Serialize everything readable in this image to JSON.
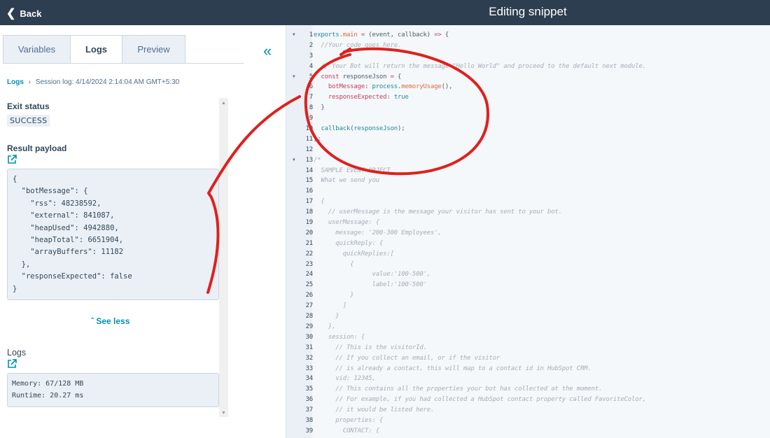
{
  "header": {
    "back_label": "Back",
    "title": "Editing snippet"
  },
  "tabs": [
    {
      "label": "Variables"
    },
    {
      "label": "Logs"
    },
    {
      "label": "Preview"
    }
  ],
  "breadcrumb": {
    "root": "Logs",
    "separator": "›",
    "current": "Session log: 4/14/2024 2:14:04 AM GMT+5:30"
  },
  "exit_status": {
    "heading": "Exit status",
    "value": "SUCCESS"
  },
  "result_payload": {
    "heading": "Result payload",
    "lines": [
      "{",
      "  \"botMessage\": {",
      "    \"rss\": 48238592,",
      "    \"external\": 841087,",
      "    \"heapUsed\": 4942880,",
      "    \"heapTotal\": 6651904,",
      "    \"arrayBuffers\": 11182",
      "  },",
      "  \"responseExpected\": false",
      "}"
    ]
  },
  "see_less_label": "See less",
  "logs": {
    "heading": "Logs",
    "lines": [
      "Memory: 67/128 MB",
      "Runtime: 20.27 ms"
    ]
  },
  "annotation_color": "#e0201c",
  "code_folds": [
    1,
    5,
    13
  ],
  "code": [
    [
      [
        "exports",
        "t"
      ],
      [
        ".",
        "p"
      ],
      [
        "main",
        "f"
      ],
      [
        " = ",
        "k"
      ],
      [
        "(event, callback) ",
        "p"
      ],
      [
        "=>",
        "k"
      ],
      [
        " {",
        "p"
      ]
    ],
    [
      [
        "  //Your code goes here.",
        "c"
      ]
    ],
    [],
    [
      [
        "  // Your Bot will return the message \"Hello World\" and proceed to the default next module.",
        "c"
      ]
    ],
    [
      [
        "  ",
        "p"
      ],
      [
        "const",
        "k"
      ],
      [
        " responseJson ",
        "p"
      ],
      [
        "=",
        "k"
      ],
      [
        " {",
        "p"
      ]
    ],
    [
      [
        "    ",
        "p"
      ],
      [
        "botMessage",
        "k"
      ],
      [
        ": ",
        "p"
      ],
      [
        "process",
        "t"
      ],
      [
        ".",
        "p"
      ],
      [
        "memoryUsage",
        "f"
      ],
      [
        "(),",
        "p"
      ]
    ],
    [
      [
        "    ",
        "p"
      ],
      [
        "responseExpected",
        "k"
      ],
      [
        ": ",
        "p"
      ],
      [
        "true",
        "t"
      ]
    ],
    [
      [
        "  }",
        "p"
      ]
    ],
    [],
    [
      [
        "  ",
        "p"
      ],
      [
        "callback",
        "t"
      ],
      [
        "(",
        "p"
      ],
      [
        "responseJson",
        "t"
      ],
      [
        ");",
        "p"
      ]
    ],
    [
      [
        "};",
        "p"
      ]
    ],
    [],
    [
      [
        "/*",
        "c"
      ]
    ],
    [
      [
        "  SAMPLE EVENT OBJECT",
        "c"
      ]
    ],
    [
      [
        "  What we send you",
        "c"
      ]
    ],
    [],
    [
      [
        "  {",
        "c"
      ]
    ],
    [
      [
        "    // userMessage is the message your visitor has sent to your bot.",
        "c"
      ]
    ],
    [
      [
        "    userMessage: {",
        "c"
      ]
    ],
    [
      [
        "      message: '200-300 Employees',",
        "c"
      ]
    ],
    [
      [
        "      quickReply: {",
        "c"
      ]
    ],
    [
      [
        "        quickReplies:[",
        "c"
      ]
    ],
    [
      [
        "          {",
        "c"
      ]
    ],
    [
      [
        "                value:'100-500',",
        "c"
      ]
    ],
    [
      [
        "                label:'100-500'",
        "c"
      ]
    ],
    [
      [
        "          }",
        "c"
      ]
    ],
    [
      [
        "        ]",
        "c"
      ]
    ],
    [
      [
        "      }",
        "c"
      ]
    ],
    [
      [
        "    },",
        "c"
      ]
    ],
    [
      [
        "    session: {",
        "c"
      ]
    ],
    [
      [
        "      // This is the visitorId.",
        "c"
      ]
    ],
    [
      [
        "      // If you collect an email, or if the visitor",
        "c"
      ]
    ],
    [
      [
        "      // is already a contact, this will map to a contact id in HubSpot CRM.",
        "c"
      ]
    ],
    [
      [
        "      vid: 12345,",
        "c"
      ]
    ],
    [
      [
        "      // This contains all the properties your bot has collected at the moment.",
        "c"
      ]
    ],
    [
      [
        "      // For example, if you had collected a HubSpot contact property called FavoriteColor,",
        "c"
      ]
    ],
    [
      [
        "      // it would be listed here.",
        "c"
      ]
    ],
    [
      [
        "      properties: {",
        "c"
      ]
    ],
    [
      [
        "        CONTACT: {",
        "c"
      ]
    ]
  ]
}
